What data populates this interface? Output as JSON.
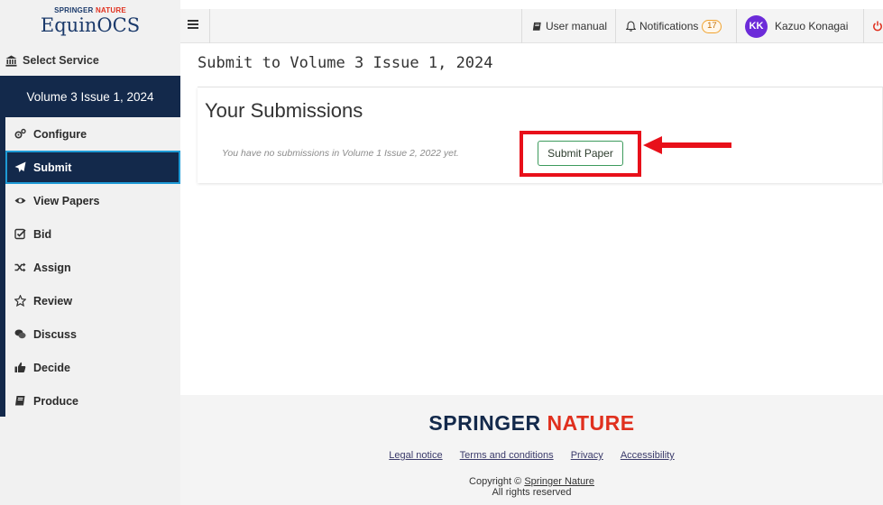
{
  "brand": {
    "publisher_top": "SPRINGER",
    "publisher_accent": "NATURE",
    "app_name": "EquinOCS"
  },
  "sidebar": {
    "select_service": "Select Service",
    "volume_title": "Volume 3 Issue 1, 2024",
    "items": [
      {
        "label": "Configure",
        "icon": "cogs-icon"
      },
      {
        "label": "Submit",
        "icon": "paper-plane-icon",
        "active": true
      },
      {
        "label": "View Papers",
        "icon": "eye-icon"
      },
      {
        "label": "Bid",
        "icon": "checkbox-icon"
      },
      {
        "label": "Assign",
        "icon": "shuffle-icon"
      },
      {
        "label": "Review",
        "icon": "star-icon"
      },
      {
        "label": "Discuss",
        "icon": "comments-icon"
      },
      {
        "label": "Decide",
        "icon": "thumbs-up-icon"
      },
      {
        "label": "Produce",
        "icon": "book-icon"
      }
    ]
  },
  "topbar": {
    "user_manual": "User manual",
    "notifications_label": "Notifications",
    "notifications_count": "17",
    "user_initials": "KK",
    "user_name": "Kazuo Konagai"
  },
  "main": {
    "page_title": "Submit to Volume 3 Issue 1, 2024",
    "panel_heading": "Your Submissions",
    "empty_message": "You have no submissions in Volume 1 Issue 2, 2022 yet.",
    "submit_button": "Submit Paper"
  },
  "footer": {
    "logo_part1": "SPRINGER",
    "logo_part2": "NATURE",
    "links": [
      "Legal notice",
      "Terms and conditions",
      "Privacy",
      "Accessibility"
    ],
    "copyright_prefix": "Copyright ©",
    "copyright_link": "Springer Nature",
    "rights": "All rights reserved"
  },
  "colors": {
    "sidebar_dark": "#13294b",
    "active_border": "#1e9ad6",
    "highlight": "#e8101a",
    "button_border": "#3d9b5d",
    "badge": "#f0a330",
    "avatar": "#6c2bd9"
  }
}
